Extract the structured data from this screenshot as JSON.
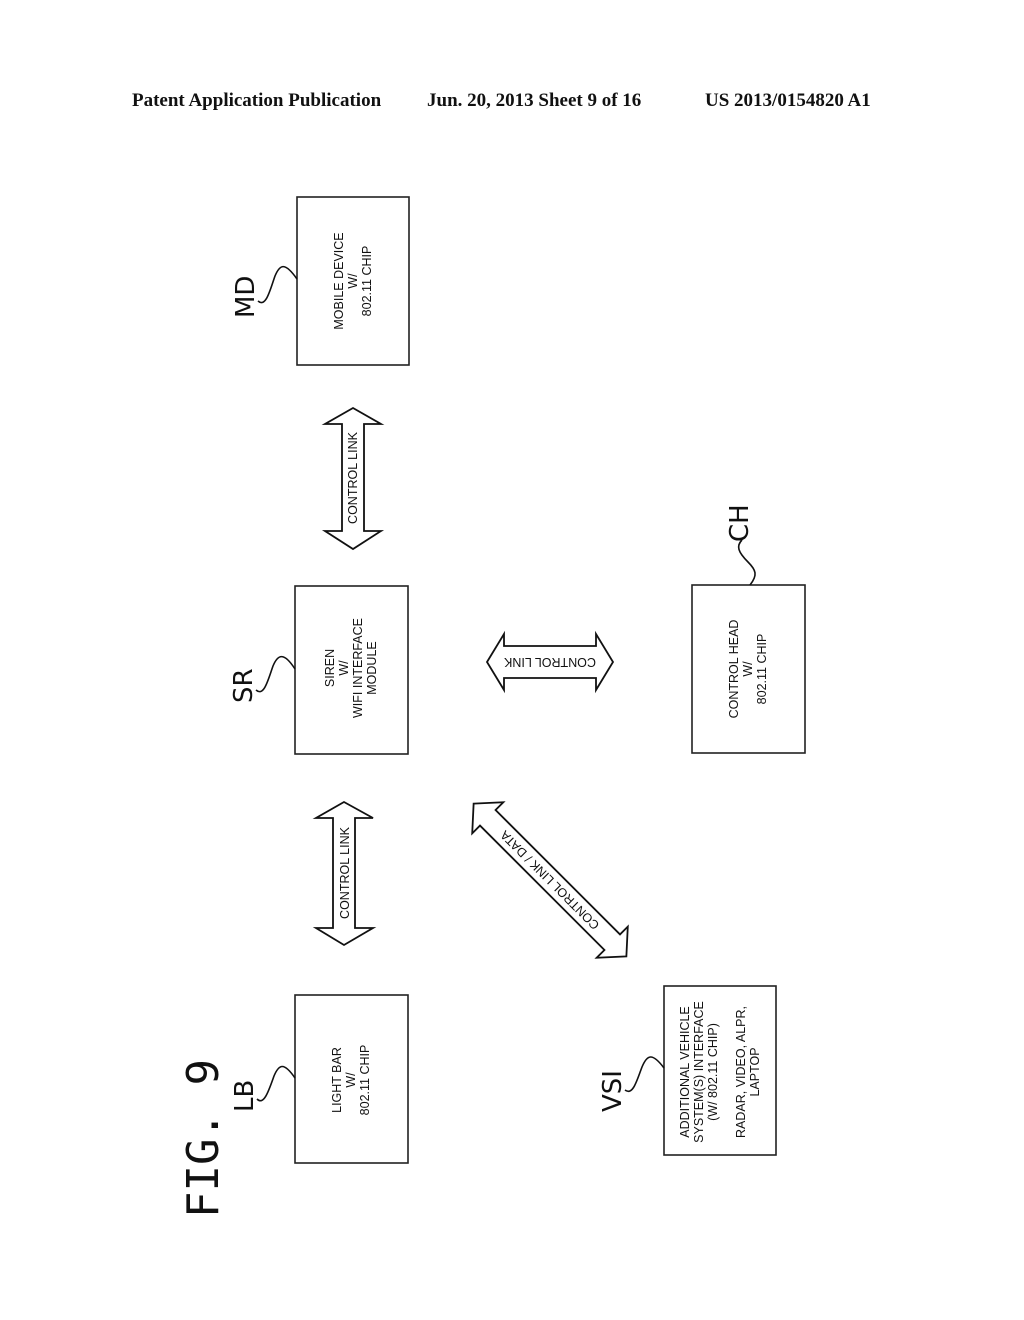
{
  "header": {
    "publication": "Patent Application Publication",
    "date_sheet": "Jun. 20, 2013  Sheet 9 of 16",
    "number": "US 2013/0154820 A1"
  },
  "figure_label": "FIG. 9",
  "blocks": {
    "md": {
      "ref": "MD",
      "lines": [
        "MOBILE DEVICE",
        "W/",
        "802.11 CHIP"
      ]
    },
    "sr": {
      "ref": "SR",
      "lines": [
        "SIREN",
        "W/",
        "WIFI INTERFACE",
        "MODULE"
      ]
    },
    "ch": {
      "ref": "CH",
      "lines": [
        "CONTROL HEAD",
        "W/",
        "802.11 CHIP"
      ]
    },
    "lb": {
      "ref": "LB",
      "lines": [
        "LIGHT BAR",
        "W/",
        "802.11 CHIP"
      ]
    },
    "vsi": {
      "ref": "VSI",
      "lines": [
        "ADDITIONAL VEHICLE",
        "SYSTEM(S) INTERFACE",
        "(W/ 802.11 CHIP)",
        "",
        "RADAR, VIDEO, ALPR,",
        "LAPTOP"
      ]
    }
  },
  "links": {
    "md_sr": "CONTROL LINK",
    "sr_ch": "CONTROL LINK",
    "lb_sr": "CONTROL LINK",
    "sr_vsi": "CONTROL LINK / DATA"
  }
}
